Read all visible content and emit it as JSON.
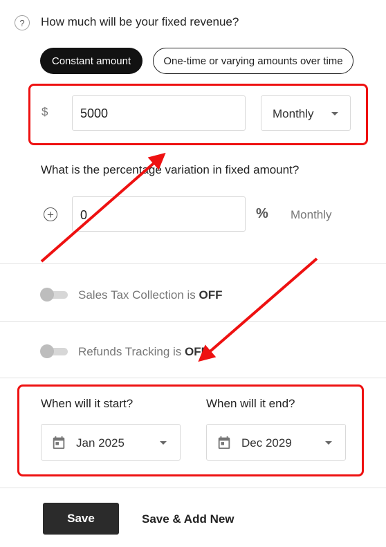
{
  "question": {
    "help_glyph": "?",
    "title": "How much will be your fixed revenue?"
  },
  "amount_type": {
    "constant_label": "Constant amount",
    "varying_label": "One-time or varying amounts over time",
    "selected": "Constant amount"
  },
  "amount": {
    "currency_symbol": "$",
    "value": "5000",
    "frequency": "Monthly"
  },
  "variation": {
    "question": "What is the percentage variation in fixed amount?",
    "value": "0",
    "percent_glyph": "%",
    "frequency": "Monthly"
  },
  "sales_tax": {
    "label": "Sales Tax Collection is",
    "state": "OFF"
  },
  "refunds": {
    "label": "Refunds Tracking is",
    "state": "OFF"
  },
  "dates": {
    "start_label": "When will it start?",
    "start_value": "Jan 2025",
    "end_label": "When will it end?",
    "end_value": "Dec 2029"
  },
  "actions": {
    "save_label": "Save",
    "save_add_label": "Save & Add New"
  },
  "annotation_color": "#ee1111"
}
